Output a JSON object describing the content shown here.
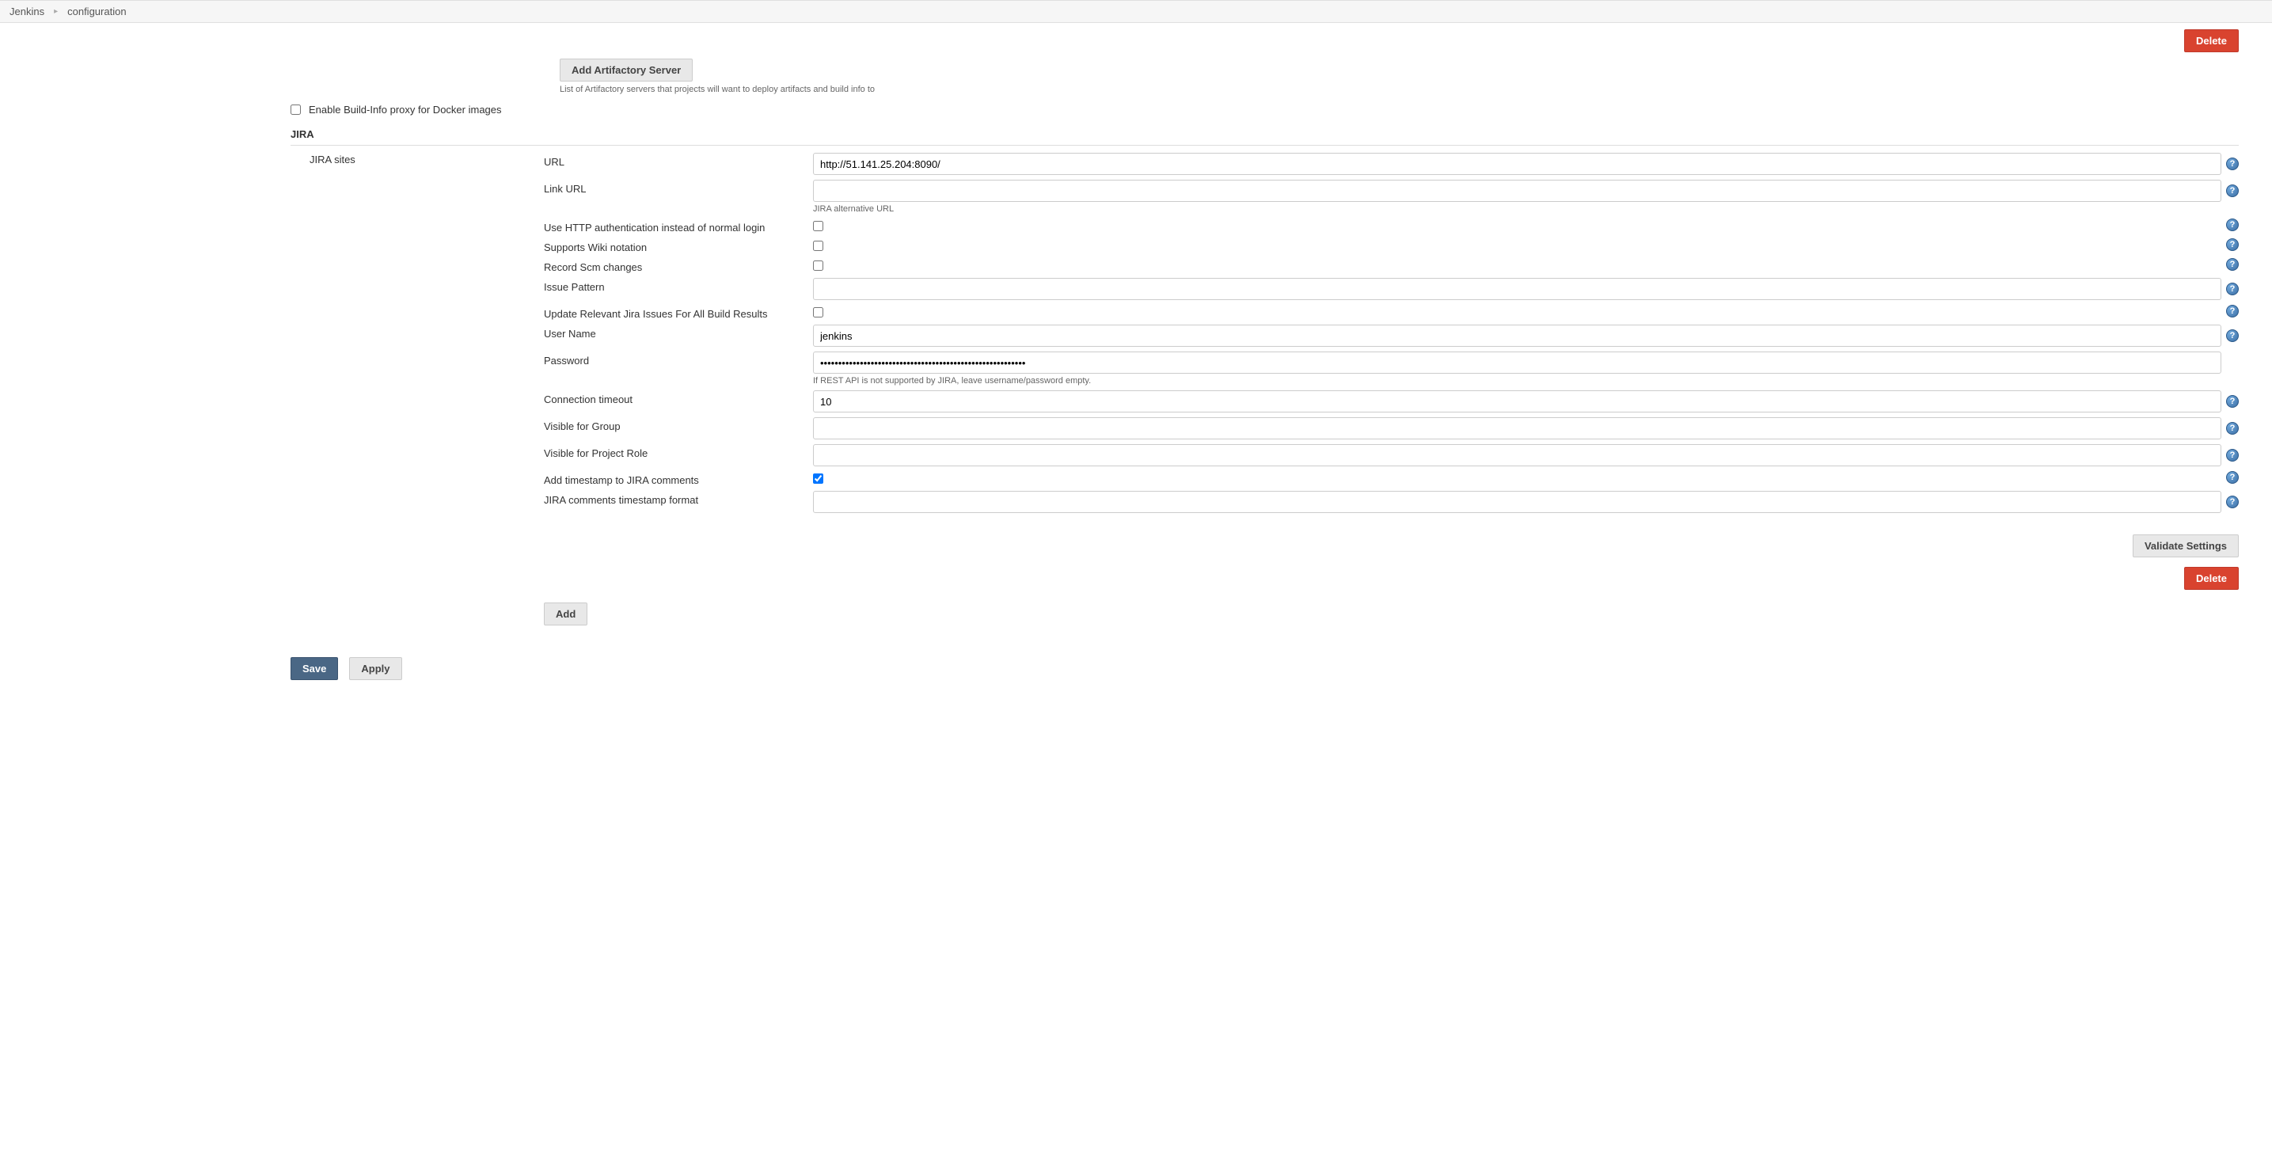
{
  "breadcrumb": {
    "jenkins": "Jenkins",
    "page": "configuration"
  },
  "buttons": {
    "delete_top": "Delete",
    "add_artifactory": "Add Artifactory Server",
    "validate": "Validate Settings",
    "delete_jira": "Delete",
    "add": "Add",
    "save": "Save",
    "apply": "Apply"
  },
  "artifactory": {
    "desc": "List of Artifactory servers that projects will want to deploy artifacts and build info to"
  },
  "docker_proxy": {
    "label": "Enable Build-Info proxy for Docker images",
    "checked": false
  },
  "jira": {
    "header": "JIRA",
    "sites_label": "JIRA sites",
    "fields": {
      "url": {
        "label": "URL",
        "value": "http://51.141.25.204:8090/"
      },
      "link_url": {
        "label": "Link URL",
        "value": "",
        "help": "JIRA alternative URL"
      },
      "http_auth": {
        "label": "Use HTTP authentication instead of normal login",
        "checked": false
      },
      "wiki": {
        "label": "Supports Wiki notation",
        "checked": false
      },
      "scm": {
        "label": "Record Scm changes",
        "checked": false
      },
      "issue_pattern": {
        "label": "Issue Pattern",
        "value": ""
      },
      "update_all": {
        "label": "Update Relevant Jira Issues For All Build Results",
        "checked": false
      },
      "username": {
        "label": "User Name",
        "value": "jenkins"
      },
      "password": {
        "label": "Password",
        "value": "•••••••••••••••••••••••••••••••••••••••••••••••••••••••••",
        "help": "If REST API is not supported by JIRA, leave username/password empty."
      },
      "timeout": {
        "label": "Connection timeout",
        "value": "10"
      },
      "visible_group": {
        "label": "Visible for Group",
        "value": ""
      },
      "visible_role": {
        "label": "Visible for Project Role",
        "value": ""
      },
      "add_ts": {
        "label": "Add timestamp to JIRA comments",
        "checked": true
      },
      "ts_format": {
        "label": "JIRA comments timestamp format",
        "value": ""
      }
    }
  }
}
